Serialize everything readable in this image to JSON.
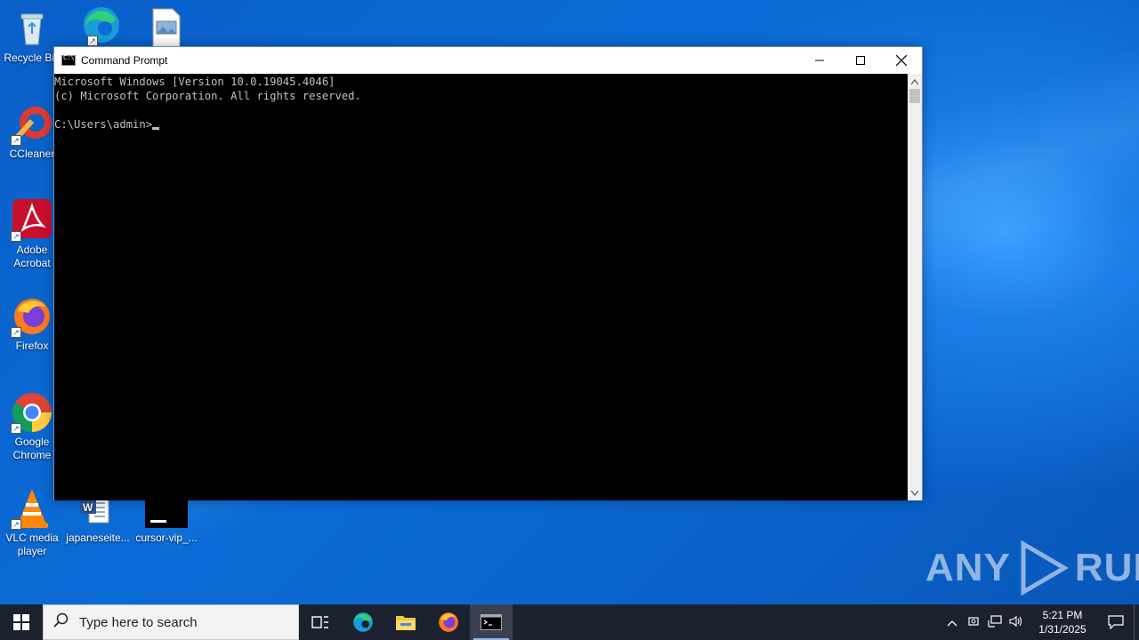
{
  "desktop": {
    "icons": [
      {
        "label": "Recycle Bin",
        "icon": "recycle-bin-icon"
      },
      {
        "label": "",
        "icon": "edge-icon"
      },
      {
        "label": "",
        "icon": "image-file-icon"
      },
      {
        "label": "CCleaner",
        "icon": "ccleaner-icon"
      },
      {
        "label": "Adobe Acrobat",
        "icon": "adobe-acrobat-icon"
      },
      {
        "label": "Firefox",
        "icon": "firefox-icon"
      },
      {
        "label": "Google Chrome",
        "icon": "chrome-icon"
      },
      {
        "label": "VLC media player",
        "icon": "vlc-icon"
      },
      {
        "label": "japaneseite...",
        "icon": "word-document-icon"
      },
      {
        "label": "cursor-vip_...",
        "icon": "console-app-icon"
      }
    ]
  },
  "window": {
    "title": "Command Prompt",
    "controls": {
      "minimize": "—",
      "maximize": "☐",
      "close": "✕"
    },
    "console_lines": [
      "Microsoft Windows [Version 10.0.19045.4046]",
      "(c) Microsoft Corporation. All rights reserved.",
      "",
      "C:\\Users\\admin>"
    ]
  },
  "watermark": {
    "left": "ANY",
    "right": "RUN"
  },
  "taskbar": {
    "search_placeholder": "Type here to search",
    "pinned": [
      "task-view-icon",
      "edge-icon",
      "file-explorer-icon",
      "firefox-icon",
      "command-prompt-icon"
    ],
    "active": "command-prompt-icon",
    "clock": {
      "time": "5:21 PM",
      "date": "1/31/2025"
    }
  }
}
